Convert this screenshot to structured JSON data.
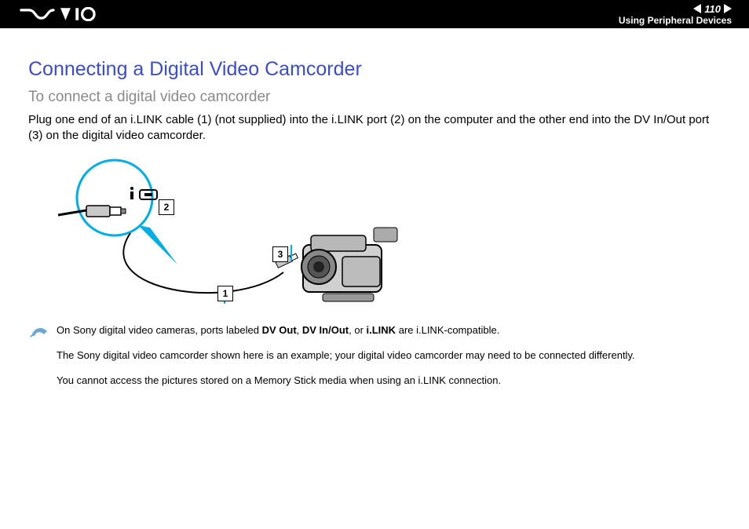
{
  "header": {
    "page_number": "110",
    "section": "Using Peripheral Devices"
  },
  "title": "Connecting a Digital Video Camcorder",
  "subtitle": "To connect a digital video camcorder",
  "body": "Plug one end of an i.LINK cable (1) (not supplied) into the i.LINK port (2) on the computer and the other end into the DV In/Out port (3) on the digital video camcorder.",
  "diagram": {
    "labels": {
      "1": "1",
      "2": "2",
      "3": "3"
    }
  },
  "notes": {
    "n1_pre": "On Sony digital video cameras, ports labeled ",
    "n1_b1": "DV Out",
    "n1_m1": ", ",
    "n1_b2": "DV In/Out",
    "n1_m2": ", or ",
    "n1_b3": "i.LINK",
    "n1_post": " are i.LINK-compatible.",
    "n2": "The Sony digital video camcorder shown here is an example; your digital video camcorder may need to be connected differently.",
    "n3": "You cannot access the pictures stored on a Memory Stick media when using an i.LINK connection."
  }
}
